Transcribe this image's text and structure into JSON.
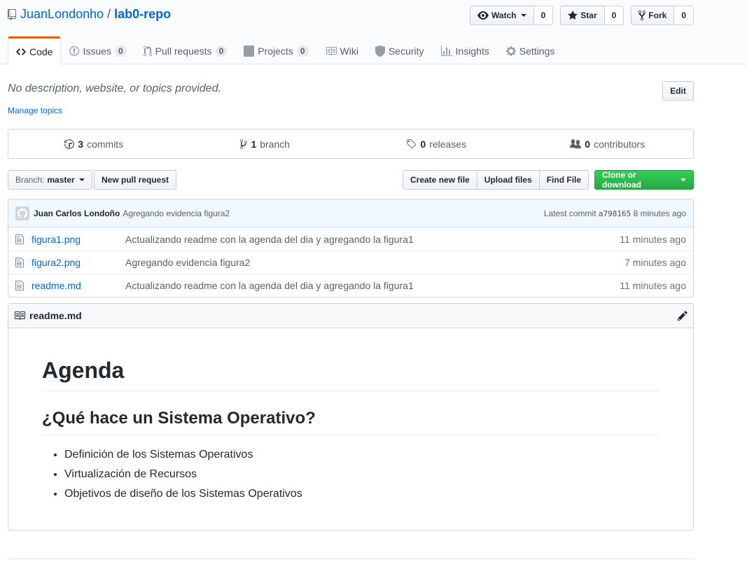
{
  "repo": {
    "owner": "JuanLondonho",
    "separator": "/",
    "name": "lab0-repo"
  },
  "actions": {
    "watch_label": "Watch",
    "watch_count": "0",
    "star_label": "Star",
    "star_count": "0",
    "fork_label": "Fork",
    "fork_count": "0"
  },
  "nav": {
    "code": "Code",
    "issues": "Issues",
    "issues_count": "0",
    "pull_requests": "Pull requests",
    "pull_requests_count": "0",
    "projects": "Projects",
    "projects_count": "0",
    "wiki": "Wiki",
    "security": "Security",
    "insights": "Insights",
    "settings": "Settings"
  },
  "about": {
    "description": "No description, website, or topics provided.",
    "manage_topics": "Manage topics",
    "edit_label": "Edit"
  },
  "summary": {
    "commits_num": "3",
    "commits_label": "commits",
    "branch_num": "1",
    "branch_label": "branch",
    "releases_num": "0",
    "releases_label": "releases",
    "contributors_num": "0",
    "contributors_label": "contributors"
  },
  "filenav": {
    "branch_prefix": "Branch:",
    "branch_name": "master",
    "new_pr": "New pull request",
    "create_file": "Create new file",
    "upload_files": "Upload files",
    "find_file": "Find File",
    "clone": "Clone or download"
  },
  "commit": {
    "author": "Juan Carlos Londoño",
    "message": "Agregando evidencia figura2",
    "latest_prefix": "Latest commit",
    "sha": "a798165",
    "age": "8 minutes ago"
  },
  "files": [
    {
      "name": "figura1.png",
      "message": "Actualizando readme con la agenda del dia y agregando la figura1",
      "age": "11 minutes ago"
    },
    {
      "name": "figura2.png",
      "message": "Agregando evidencia figura2",
      "age": "7 minutes ago"
    },
    {
      "name": "readme.md",
      "message": "Actualizando readme con la agenda del dia y agregando la figura1",
      "age": "11 minutes ago"
    }
  ],
  "readme": {
    "filename": "readme.md",
    "h1": "Agenda",
    "h2": "¿Qué hace un Sistema Operativo?",
    "items": [
      "Definición de los Sistemas Operativos",
      "Virtualización de Recursos",
      "Objetivos de diseño de los Sistemas Operativos"
    ]
  },
  "colors": {
    "link": "#0366d6",
    "accent_tab": "#e36209",
    "clone_green": "#28a745"
  }
}
